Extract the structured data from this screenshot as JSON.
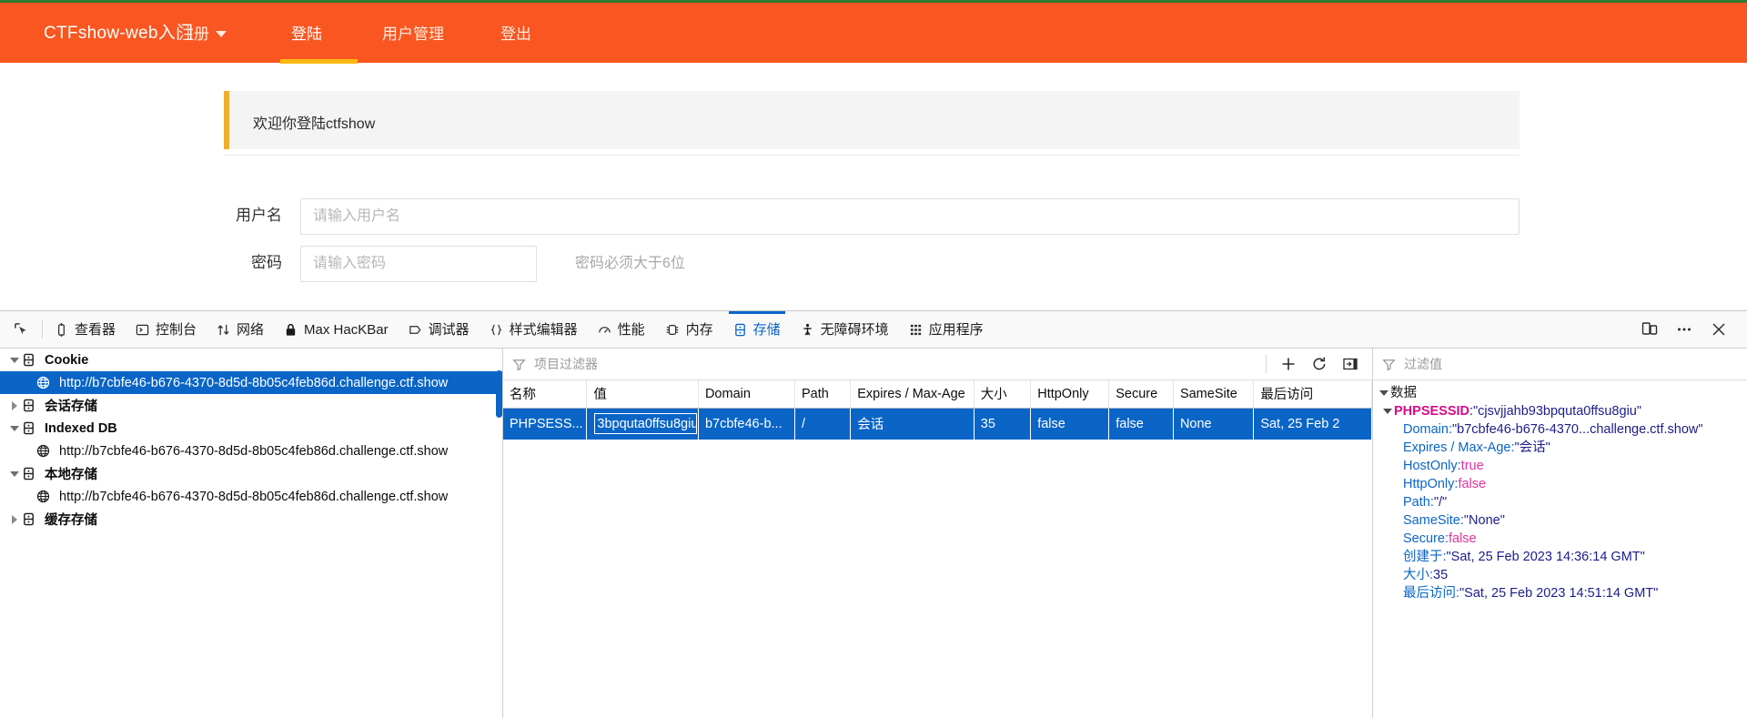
{
  "site": {
    "brand": "CTFshow-web入门",
    "nav": [
      {
        "label": "注册",
        "has_caret": true,
        "active": false
      },
      {
        "label": "登陆",
        "has_caret": false,
        "active": true
      },
      {
        "label": "用户管理",
        "has_caret": false,
        "active": false
      },
      {
        "label": "登出",
        "has_caret": false,
        "active": false
      }
    ],
    "alert": "欢迎你登陆ctfshow",
    "form": {
      "username_label": "用户名",
      "username_placeholder": "请输入用户名",
      "username_value": "",
      "password_label": "密码",
      "password_placeholder": "请输入密码",
      "password_value": "",
      "password_hint": "密码必须大于6位"
    },
    "colors": {
      "navbar": "#f95621",
      "accent_underline": "#fcb913",
      "top_strip": "#2e7d32",
      "alert_bar": "#f0ad2e"
    }
  },
  "devtools": {
    "picker_icon": "element-picker-icon",
    "tabs": [
      {
        "label": "查看器",
        "icon": "inspector-icon",
        "selected": false
      },
      {
        "label": "控制台",
        "icon": "console-icon",
        "selected": false
      },
      {
        "label": "网络",
        "icon": "network-icon",
        "selected": false
      },
      {
        "label": "Max HacKBar",
        "icon": "lock-icon",
        "selected": false
      },
      {
        "label": "调试器",
        "icon": "debugger-icon",
        "selected": false
      },
      {
        "label": "样式编辑器",
        "icon": "style-editor-icon",
        "selected": false
      },
      {
        "label": "性能",
        "icon": "performance-icon",
        "selected": false
      },
      {
        "label": "内存",
        "icon": "memory-icon",
        "selected": false
      },
      {
        "label": "存储",
        "icon": "storage-icon",
        "selected": true
      },
      {
        "label": "无障碍环境",
        "icon": "accessibility-icon",
        "selected": false
      },
      {
        "label": "应用程序",
        "icon": "application-icon",
        "selected": false
      }
    ],
    "toolbar_right": [
      {
        "icon": "responsive-design-mode-icon"
      },
      {
        "icon": "meatball-menu-icon"
      },
      {
        "icon": "close-icon"
      }
    ],
    "selected_tab_color": "#0a65c7",
    "sidebar": {
      "items": [
        {
          "label": "Cookie",
          "type": "group",
          "expanded": true,
          "selected": false,
          "icon": "storage-db-icon"
        },
        {
          "label": "http://b7cbfe46-b676-4370-8d5d-8b05c4feb86d.challenge.ctf.show",
          "type": "child",
          "selected": true,
          "icon": "globe-icon"
        },
        {
          "label": "会话存储",
          "type": "group",
          "expanded": false,
          "selected": false,
          "icon": "storage-db-icon"
        },
        {
          "label": "Indexed DB",
          "type": "group",
          "expanded": true,
          "selected": false,
          "icon": "storage-db-icon"
        },
        {
          "label": "http://b7cbfe46-b676-4370-8d5d-8b05c4feb86d.challenge.ctf.show",
          "type": "child",
          "selected": false,
          "icon": "globe-icon"
        },
        {
          "label": "本地存储",
          "type": "group",
          "expanded": true,
          "selected": false,
          "icon": "storage-db-icon"
        },
        {
          "label": "http://b7cbfe46-b676-4370-8d5d-8b05c4feb86d.challenge.ctf.show",
          "type": "child",
          "selected": false,
          "icon": "globe-icon"
        },
        {
          "label": "缓存存储",
          "type": "group",
          "expanded": false,
          "selected": false,
          "icon": "storage-db-icon"
        }
      ]
    },
    "main": {
      "filter_placeholder": "项目过滤器",
      "filter_value": "",
      "actions": [
        {
          "icon": "plus-icon",
          "name": "add-item-button"
        },
        {
          "icon": "refresh-icon",
          "name": "refresh-button"
        },
        {
          "icon": "sidebar-toggle-icon",
          "name": "toggle-sidebar-button"
        }
      ],
      "columns": [
        "名称",
        "值",
        "Domain",
        "Path",
        "Expires / Max-Age",
        "大小",
        "HttpOnly",
        "Secure",
        "SameSite",
        "最后访问"
      ],
      "rows": [
        {
          "selected": true,
          "editing_column_index": 1,
          "cells": [
            "PHPSESS...",
            "3bpquta0ffsu8giu",
            "b7cbfe46-b...",
            "/",
            "会话",
            "35",
            "false",
            "false",
            "None",
            "Sat, 25 Feb 2"
          ]
        }
      ]
    },
    "aside": {
      "filter_placeholder": "过滤值",
      "filter_value": "",
      "root_label": "数据",
      "cookie_name": "PHPSESSID",
      "cookie_value": "\"cjsvjjahb93bpquta0ffsu8giu\"",
      "properties": [
        {
          "key": "Domain",
          "value": "\"b7cbfe46-b676-4370...challenge.ctf.show\"",
          "kind": "string"
        },
        {
          "key": "Expires / Max-Age",
          "value": "\"会话\"",
          "kind": "string"
        },
        {
          "key": "HostOnly",
          "value": "true",
          "kind": "bool"
        },
        {
          "key": "HttpOnly",
          "value": "false",
          "kind": "bool"
        },
        {
          "key": "Path",
          "value": "\"/\"",
          "kind": "string"
        },
        {
          "key": "SameSite",
          "value": "\"None\"",
          "kind": "string"
        },
        {
          "key": "Secure",
          "value": "false",
          "kind": "bool"
        },
        {
          "key": "创建于",
          "value": "\"Sat, 25 Feb 2023 14:36:14 GMT\"",
          "kind": "string"
        },
        {
          "key": "大小",
          "value": "35",
          "kind": "number"
        },
        {
          "key": "最后访问",
          "value": "\"Sat, 25 Feb 2023 14:51:14 GMT\"",
          "kind": "string"
        }
      ]
    }
  }
}
